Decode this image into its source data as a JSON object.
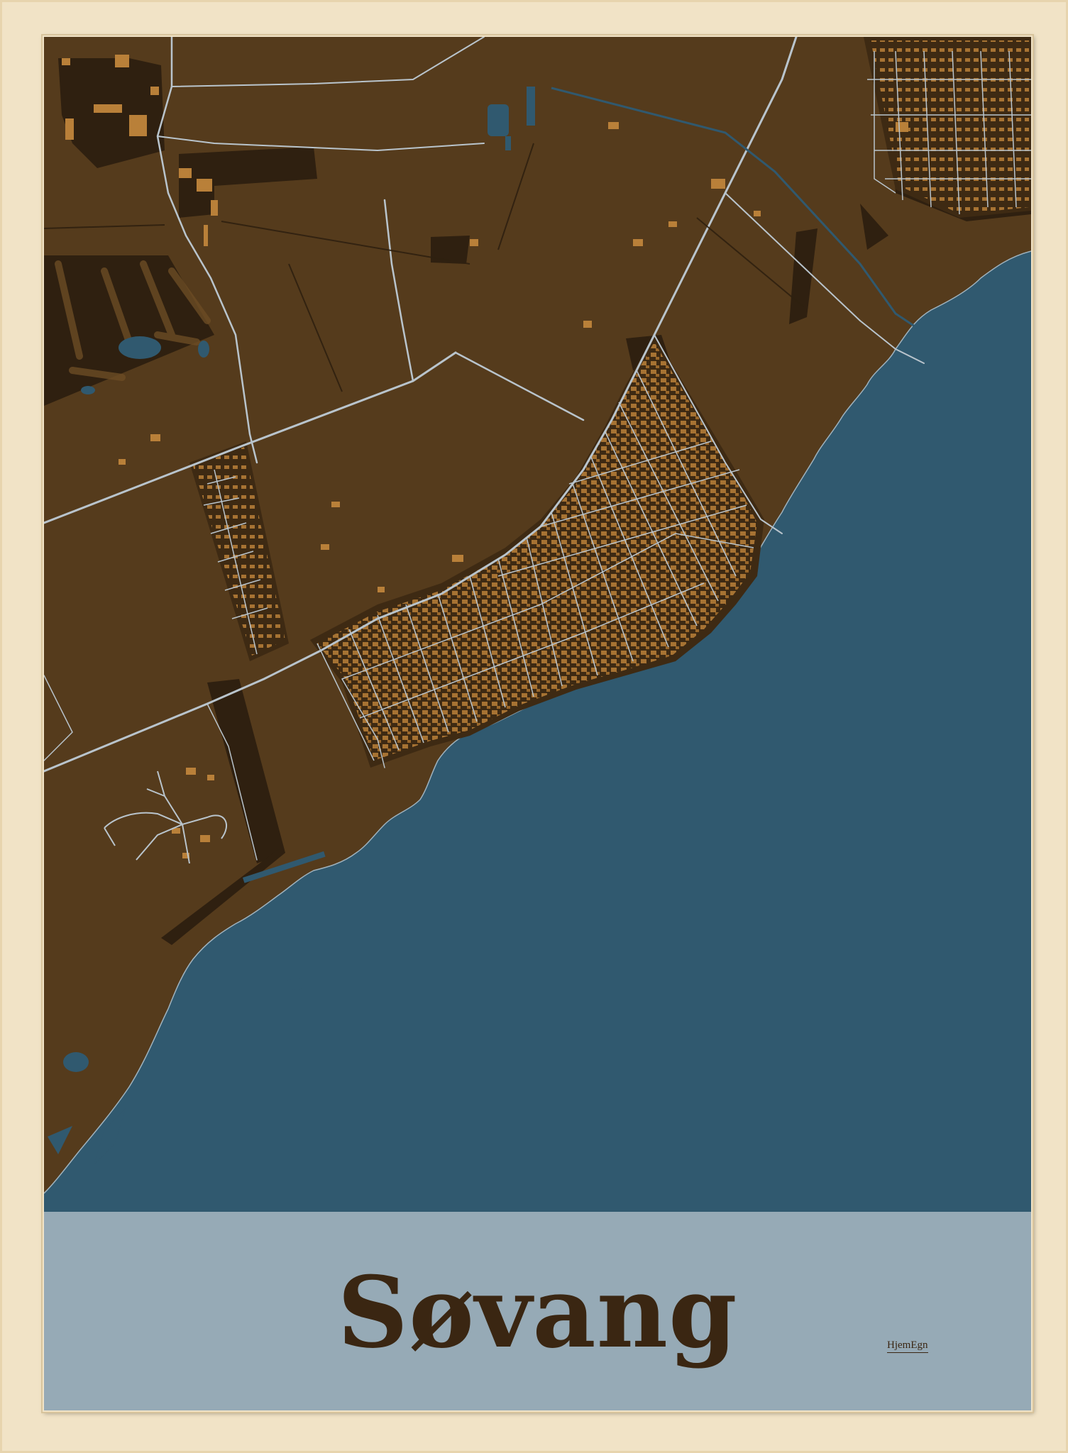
{
  "poster": {
    "city_name": "Søvang",
    "brand": "HjemEgn"
  },
  "colors": {
    "frame": "#f1e3c6",
    "land": "#553b1c",
    "dark_areas": "#2f2010",
    "buildings": "#b98039",
    "water": "#30596f",
    "roads": "#b9c4cc",
    "title_panel": "#96aab6",
    "title_text": "#3a2612"
  }
}
